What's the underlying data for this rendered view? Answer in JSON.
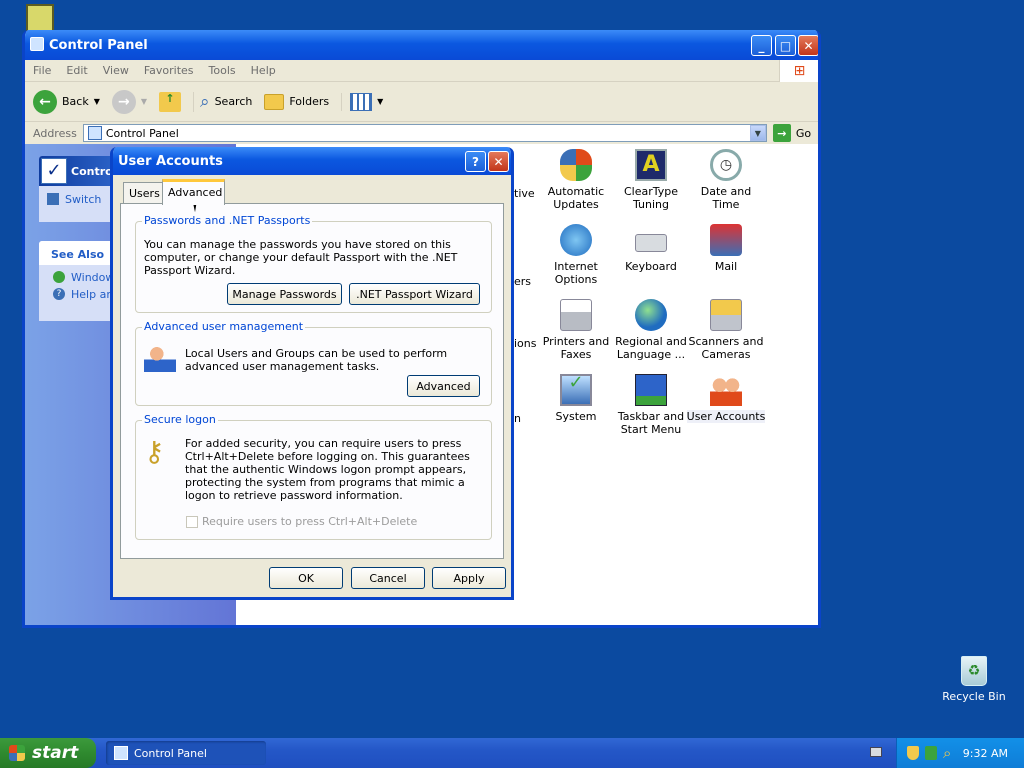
{
  "desktop": {
    "recycle_bin_label": "Recycle Bin"
  },
  "window": {
    "title": "Control Panel",
    "menu": [
      "File",
      "Edit",
      "View",
      "Favorites",
      "Tools",
      "Help"
    ],
    "toolbar": {
      "back": "Back",
      "search": "Search",
      "folders": "Folders"
    },
    "address": {
      "label": "Address",
      "value": "Control Panel",
      "go": "Go"
    },
    "left_pane": {
      "control_panel_title": "Contro",
      "switch_link": "Switch",
      "see_also_title": "See Also",
      "see_also_items": [
        "Window",
        "Help an"
      ]
    },
    "icons_partial": [
      "tive",
      "ers",
      "ions",
      "n"
    ],
    "icons": [
      {
        "label": "Automatic Updates",
        "icon": "automatic-updates-icon"
      },
      {
        "label": "ClearType Tuning",
        "icon": "cleartype-icon"
      },
      {
        "label": "Date and Time",
        "icon": "date-time-icon"
      },
      {
        "label": "Internet Options",
        "icon": "internet-options-icon"
      },
      {
        "label": "Keyboard",
        "icon": "keyboard-icon"
      },
      {
        "label": "Mail",
        "icon": "mail-icon"
      },
      {
        "label": "Printers and Faxes",
        "icon": "printer-icon"
      },
      {
        "label": "Regional and Language ...",
        "icon": "globe-icon"
      },
      {
        "label": "Scanners and Cameras",
        "icon": "scanner-icon"
      },
      {
        "label": "System",
        "icon": "system-icon"
      },
      {
        "label": "Taskbar and Start Menu",
        "icon": "taskbar-icon"
      },
      {
        "label": "User Accounts",
        "icon": "users-icon"
      }
    ]
  },
  "dialog": {
    "title": "User Accounts",
    "help_button": "?",
    "tabs": [
      "Users",
      "Advanced"
    ],
    "active_tab": "Advanced",
    "passwords_group": {
      "label": "Passwords and .NET Passports",
      "text": "You can manage the passwords you have stored on this computer, or change your default Passport with the .NET Passport Wizard.",
      "manage_button": "Manage Passwords",
      "wizard_button": ".NET Passport Wizard"
    },
    "advanced_group": {
      "label": "Advanced user management",
      "text": "Local Users and Groups can be used to perform advanced user management tasks.",
      "button": "Advanced"
    },
    "secure_group": {
      "label": "Secure logon",
      "text": "For added security, you can require users to press Ctrl+Alt+Delete before logging on. This guarantees that the authentic Windows logon prompt appears, protecting the system from programs that mimic a logon to retrieve password information.",
      "checkbox_label": "Require users to press Ctrl+Alt+Delete",
      "checkbox_checked": false,
      "checkbox_enabled": false
    },
    "buttons": {
      "ok": "OK",
      "cancel": "Cancel",
      "apply": "Apply"
    }
  },
  "taskbar": {
    "start_label": "start",
    "task_label": "Control Panel",
    "clock": "9:32 AM"
  },
  "colors": {
    "desktop": "#0b4aa0",
    "titlebar": "#0b58e0",
    "taskbar": "#2457c7",
    "start_green": "#2f8a2f",
    "group_label": "#0046d5"
  }
}
